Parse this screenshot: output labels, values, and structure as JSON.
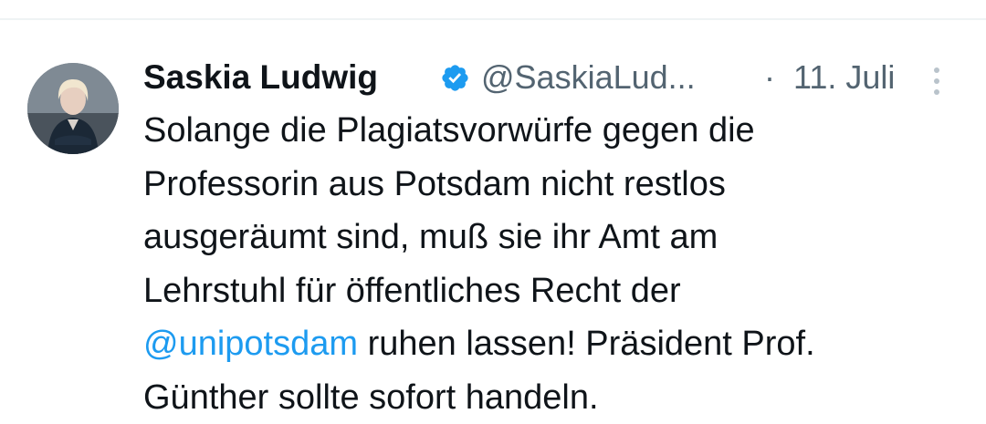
{
  "tweet": {
    "author": {
      "display_name": "Saskia Ludwig",
      "handle": "@SaskiaLud...",
      "verified": true,
      "verified_color": "#1d9bf0"
    },
    "separator": "·",
    "date": "11. Juli",
    "more_icon": "more-vertical-icon",
    "text_lines": [
      "Solange die Plagiatsvorwürfe gegen die",
      "Professorin aus Potsdam nicht restlos",
      "ausgeräumt sind, muß sie ihr Amt am",
      "Lehrstuhl für öffentliches Recht der"
    ],
    "mention": "@unipotsdam",
    "line5_rest": " ruhen lassen! Präsident Prof.",
    "line6": "Günther sollte sofort handeln.",
    "colors": {
      "text": "#0f1419",
      "secondary": "#536471",
      "link": "#1d9bf0"
    }
  }
}
